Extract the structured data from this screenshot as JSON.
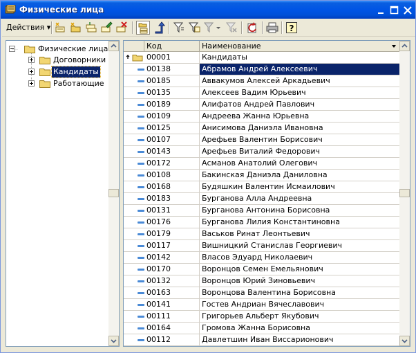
{
  "window": {
    "title": "Физические лица",
    "controls": [
      "_",
      "□",
      "×"
    ]
  },
  "toolbar": {
    "actions_label": "Действия",
    "actions_arrow": "▾",
    "tools": [
      "add-icon",
      "add-folder-icon",
      "copy-icon",
      "edit-icon",
      "delete-icon",
      "hierarchy-icon",
      "up-level-icon",
      "filter-icon",
      "filter-value-icon",
      "filter-history-icon",
      "clear-filter-icon",
      "refresh-icon",
      "print-icon",
      "help-icon"
    ]
  },
  "tree": {
    "root": "Физические лица",
    "items": [
      {
        "label": "Договорники",
        "selected": false
      },
      {
        "label": "Кандидаты",
        "selected": true
      },
      {
        "label": "Работающие",
        "selected": false
      }
    ]
  },
  "grid": {
    "columns": {
      "code": "Код",
      "name": "Наименование"
    },
    "parent_row": {
      "code": "00001",
      "name": "Кандидаты"
    },
    "rows": [
      {
        "code": "00138",
        "name": "Абрамов Андрей Алексеевич"
      },
      {
        "code": "00185",
        "name": "Аввакумов Алексей Аркадьевич"
      },
      {
        "code": "00135",
        "name": "Алексеев Вадим Юрьевич"
      },
      {
        "code": "00189",
        "name": "Алифатов Андрей Павлович"
      },
      {
        "code": "00109",
        "name": "Андреева Жанна Юрьевна"
      },
      {
        "code": "00125",
        "name": "Анисимова Даниэла Ивановна"
      },
      {
        "code": "00107",
        "name": "Арефьев Валентин Борисович"
      },
      {
        "code": "00143",
        "name": "Арефьев Виталий Федорович"
      },
      {
        "code": "00172",
        "name": "Асманов Анатолий Олегович"
      },
      {
        "code": "00108",
        "name": "Бакинская Даниэла Даниловна"
      },
      {
        "code": "00168",
        "name": "Будяшкин Валентин Исмаилович"
      },
      {
        "code": "00183",
        "name": "Бурганова Алла Андреевна"
      },
      {
        "code": "00131",
        "name": "Бурганова Антонина Борисовна"
      },
      {
        "code": "00176",
        "name": "Бурганова Лилия Константиновна"
      },
      {
        "code": "00179",
        "name": "Васьков Ринат Леонтьевич"
      },
      {
        "code": "00117",
        "name": "Вишницкий Станислав Георгиевич"
      },
      {
        "code": "00142",
        "name": "Власов Эдуард Николаевич"
      },
      {
        "code": "00170",
        "name": "Воронцов Семен Емельянович"
      },
      {
        "code": "00132",
        "name": "Воронцов Юрий Зиновьевич"
      },
      {
        "code": "00163",
        "name": "Воронцова Валентина Борисовна"
      },
      {
        "code": "00141",
        "name": "Гостев Андриан Вячеславович"
      },
      {
        "code": "00111",
        "name": "Григорьев Альберт Якубович"
      },
      {
        "code": "00164",
        "name": "Громова Жанна Борисовна"
      },
      {
        "code": "00112",
        "name": "Давлетшин Иван Виссарионович"
      }
    ]
  },
  "colors": {
    "selection": "#0a246a",
    "titlebar": "#0055e5"
  }
}
